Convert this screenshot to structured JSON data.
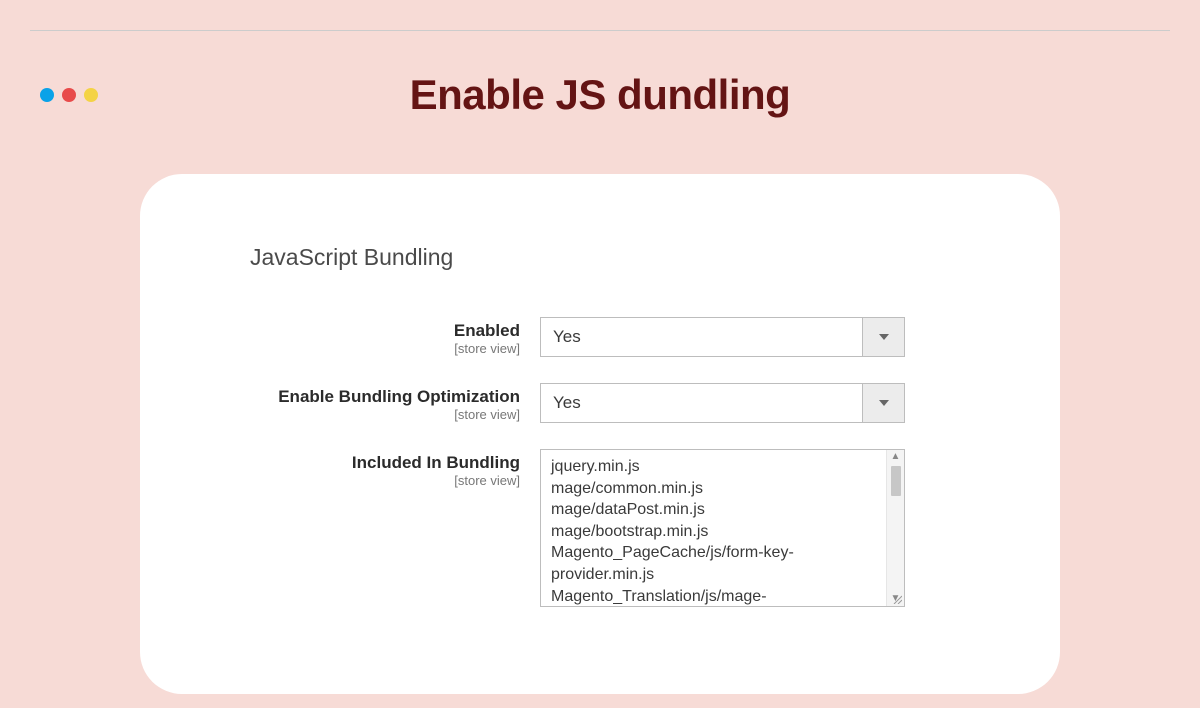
{
  "header": {
    "title": "Enable JS dundling"
  },
  "section": {
    "title": "JavaScript Bundling"
  },
  "fields": {
    "enabled": {
      "label": "Enabled",
      "scope": "[store view]",
      "value": "Yes"
    },
    "optimization": {
      "label": "Enable Bundling Optimization",
      "scope": "[store view]",
      "value": "Yes"
    },
    "included": {
      "label": "Included In Bundling",
      "scope": "[store view]",
      "value": "jquery.min.js\nmage/common.min.js\nmage/dataPost.min.js\nmage/bootstrap.min.js\nMagento_PageCache/js/form-key-provider.min.js\nMagento_Translation/js/mage-"
    }
  }
}
